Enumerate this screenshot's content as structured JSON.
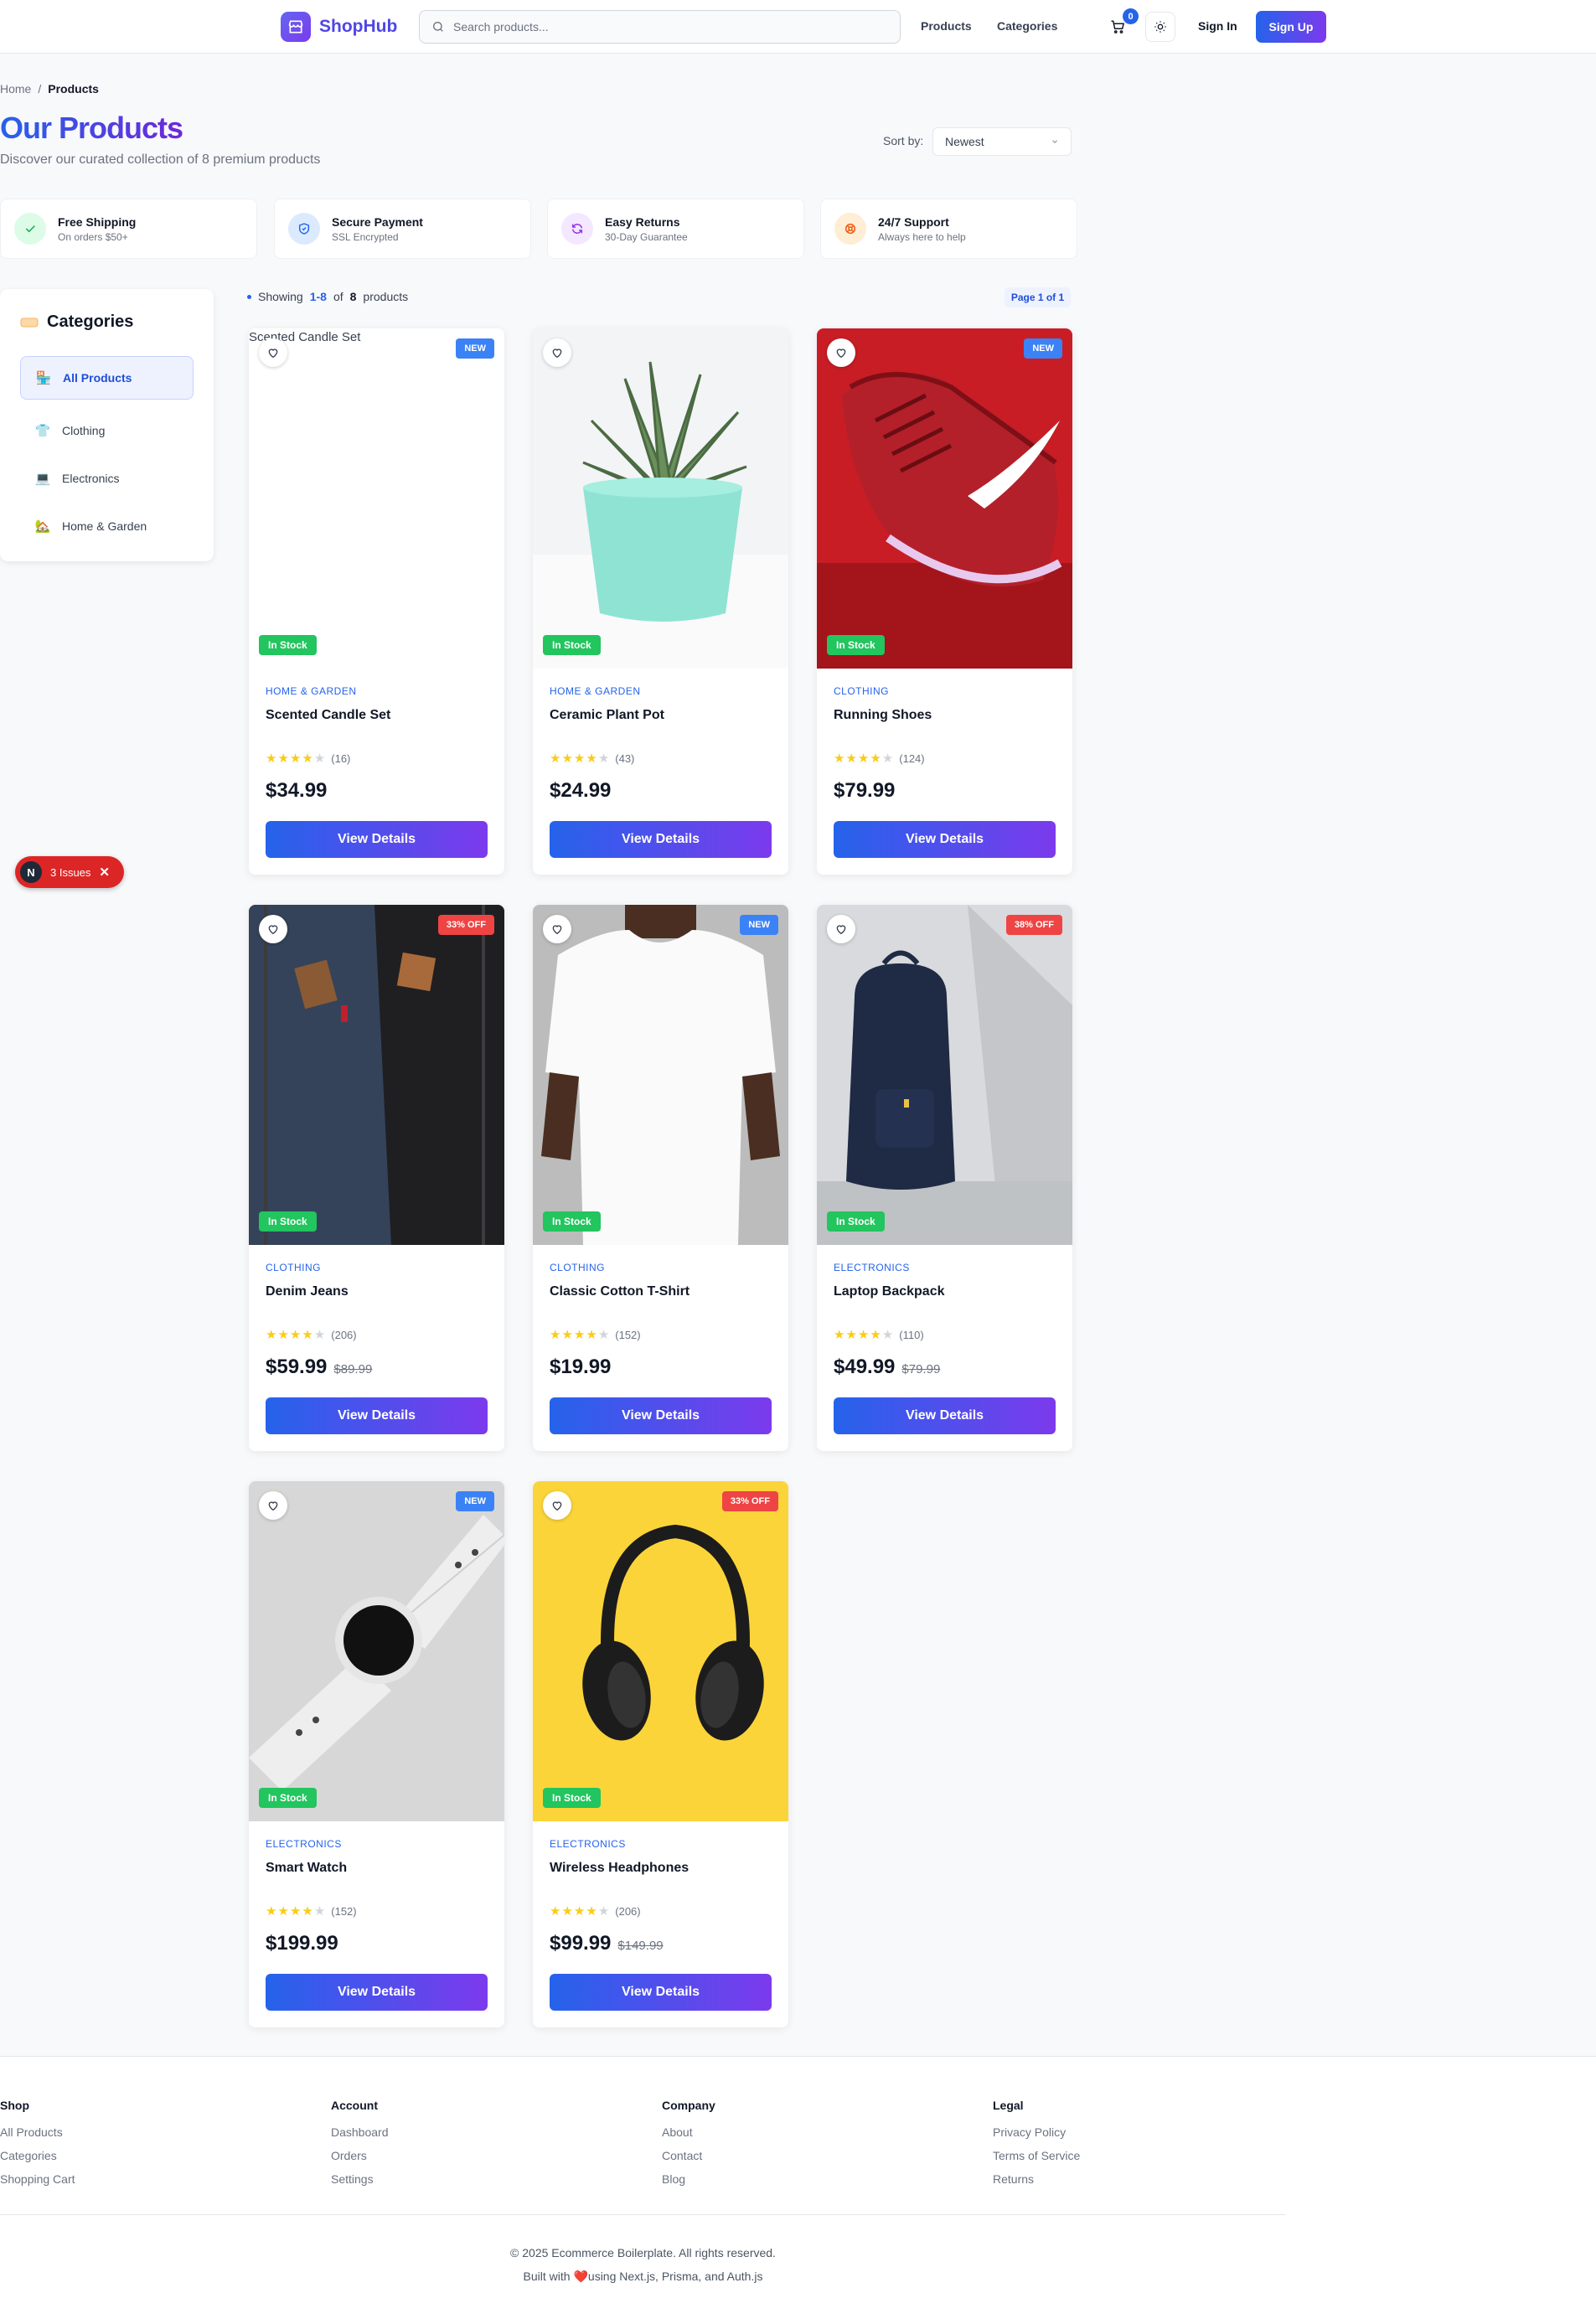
{
  "header": {
    "brand": "ShopHub",
    "search_placeholder": "Search products...",
    "nav": [
      "Products",
      "Categories"
    ],
    "cart_count": "0",
    "signin": "Sign In",
    "signup": "Sign Up"
  },
  "breadcrumb": {
    "home": "Home",
    "sep": "/",
    "current": "Products"
  },
  "page": {
    "title": "Our Products",
    "subtitle": "Discover our curated collection of 8 premium products",
    "sort_label": "Sort by:",
    "sort_value": "Newest"
  },
  "features": [
    {
      "title": "Free Shipping",
      "sub": "On orders $50+",
      "icon": "check-icon",
      "color": "#16a34a",
      "bg": "#dcfce7"
    },
    {
      "title": "Secure Payment",
      "sub": "SSL Encrypted",
      "icon": "shield-icon",
      "color": "#2563eb",
      "bg": "#dbeafe"
    },
    {
      "title": "Easy Returns",
      "sub": "30-Day Guarantee",
      "icon": "refresh-icon",
      "color": "#9333ea",
      "bg": "#f3e8ff"
    },
    {
      "title": "24/7 Support",
      "sub": "Always here to help",
      "icon": "support-icon",
      "color": "#ea580c",
      "bg": "#ffedd5"
    }
  ],
  "sidebar": {
    "title": "Categories",
    "items": [
      {
        "label": "All Products",
        "icon": "🏪"
      },
      {
        "label": "Clothing",
        "icon": "👕"
      },
      {
        "label": "Electronics",
        "icon": "💻"
      },
      {
        "label": "Home & Garden",
        "icon": "🏡"
      }
    ]
  },
  "listing": {
    "showing_prefix": "Showing",
    "range": "1-8",
    "of": "of",
    "total": "8",
    "suffix": "products",
    "page_badge": "Page 1 of 1"
  },
  "products": [
    {
      "category": "HOME & GARDEN",
      "name": "Scented Candle Set",
      "rating": 4,
      "reviews": "(16)",
      "price": "$34.99",
      "old_price": "",
      "tag": "NEW",
      "stock": "In Stock",
      "alt": "Scented Candle Set",
      "image": "broken"
    },
    {
      "category": "HOME & GARDEN",
      "name": "Ceramic Plant Pot",
      "rating": 4,
      "reviews": "(43)",
      "price": "$24.99",
      "old_price": "",
      "tag": "",
      "stock": "In Stock",
      "image": "plant"
    },
    {
      "category": "CLOTHING",
      "name": "Running Shoes",
      "rating": 4,
      "reviews": "(124)",
      "price": "$79.99",
      "old_price": "",
      "tag": "NEW",
      "stock": "In Stock",
      "image": "shoe"
    },
    {
      "category": "CLOTHING",
      "name": "Denim Jeans",
      "rating": 4,
      "reviews": "(206)",
      "price": "$59.99",
      "old_price": "$89.99",
      "tag": "33% OFF",
      "stock": "In Stock",
      "image": "jeans"
    },
    {
      "category": "CLOTHING",
      "name": "Classic Cotton T-Shirt",
      "rating": 4,
      "reviews": "(152)",
      "price": "$19.99",
      "old_price": "",
      "tag": "NEW",
      "stock": "In Stock",
      "image": "tshirt"
    },
    {
      "category": "ELECTRONICS",
      "name": "Laptop Backpack",
      "rating": 4,
      "reviews": "(110)",
      "price": "$49.99",
      "old_price": "$79.99",
      "tag": "38% OFF",
      "stock": "In Stock",
      "image": "backpack"
    },
    {
      "category": "ELECTRONICS",
      "name": "Smart Watch",
      "rating": 4,
      "reviews": "(152)",
      "price": "$199.99",
      "old_price": "",
      "tag": "NEW",
      "stock": "In Stock",
      "image": "watch"
    },
    {
      "category": "ELECTRONICS",
      "name": "Wireless Headphones",
      "rating": 4,
      "reviews": "(206)",
      "price": "$99.99",
      "old_price": "$149.99",
      "tag": "33% OFF",
      "stock": "In Stock",
      "image": "headphones"
    }
  ],
  "view_details": "View Details",
  "issues": {
    "badge": "N",
    "label": "3 Issues",
    "close": "✕"
  },
  "footer": {
    "columns": [
      {
        "title": "Shop",
        "links": [
          "All Products",
          "Categories",
          "Shopping Cart"
        ]
      },
      {
        "title": "Account",
        "links": [
          "Dashboard",
          "Orders",
          "Settings"
        ]
      },
      {
        "title": "Company",
        "links": [
          "About",
          "Contact",
          "Blog"
        ]
      },
      {
        "title": "Legal",
        "links": [
          "Privacy Policy",
          "Terms of Service",
          "Returns"
        ]
      }
    ],
    "copyright": "© 2025 Ecommerce Boilerplate. All rights reserved.",
    "built_prefix": "Built with",
    "built_suffix": "using Next.js, Prisma, and Auth.js"
  },
  "colors": {
    "accent": "#2563eb",
    "accent2": "#7c3aed",
    "success": "#22c55e",
    "danger": "#ef4444"
  }
}
